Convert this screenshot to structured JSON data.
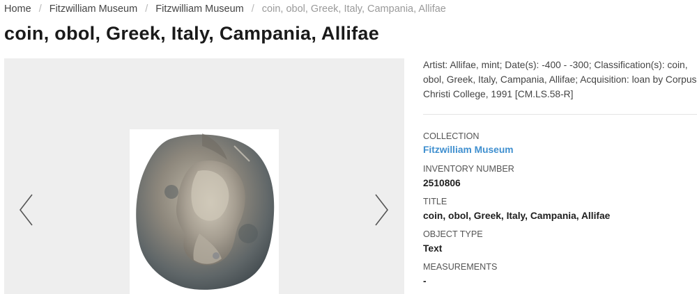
{
  "breadcrumb": {
    "items": [
      {
        "label": "Home"
      },
      {
        "label": "Fitzwilliam Museum"
      },
      {
        "label": "Fitzwilliam Museum"
      }
    ],
    "separator": "/",
    "current": "coin, obol, Greek, Italy, Campania, Allifae"
  },
  "page": {
    "title": "coin, obol, Greek, Italy, Campania, Allifae"
  },
  "viewer": {
    "prev_icon": "chevron-left-icon",
    "next_icon": "chevron-right-icon"
  },
  "description": "Artist: Allifae, mint; Date(s): -400 - -300; Classification(s): coin, obol, Greek, Italy, Campania, Allifae; Acquisition: loan by Corpus Christi College, 1991 [CM.LS.58-R]",
  "details": {
    "collection": {
      "label": "COLLECTION",
      "value": "Fitzwilliam Museum"
    },
    "inventory": {
      "label": "INVENTORY NUMBER",
      "value": "2510806"
    },
    "title": {
      "label": "TITLE",
      "value": "coin, obol, Greek, Italy, Campania, Allifae"
    },
    "object_type": {
      "label": "OBJECT TYPE",
      "value": "Text"
    },
    "measurements": {
      "label": "MEASUREMENTS",
      "value": "-"
    }
  },
  "colors": {
    "link": "#3f8fcf",
    "viewer_bg": "#eeeeee",
    "text": "#222222"
  }
}
